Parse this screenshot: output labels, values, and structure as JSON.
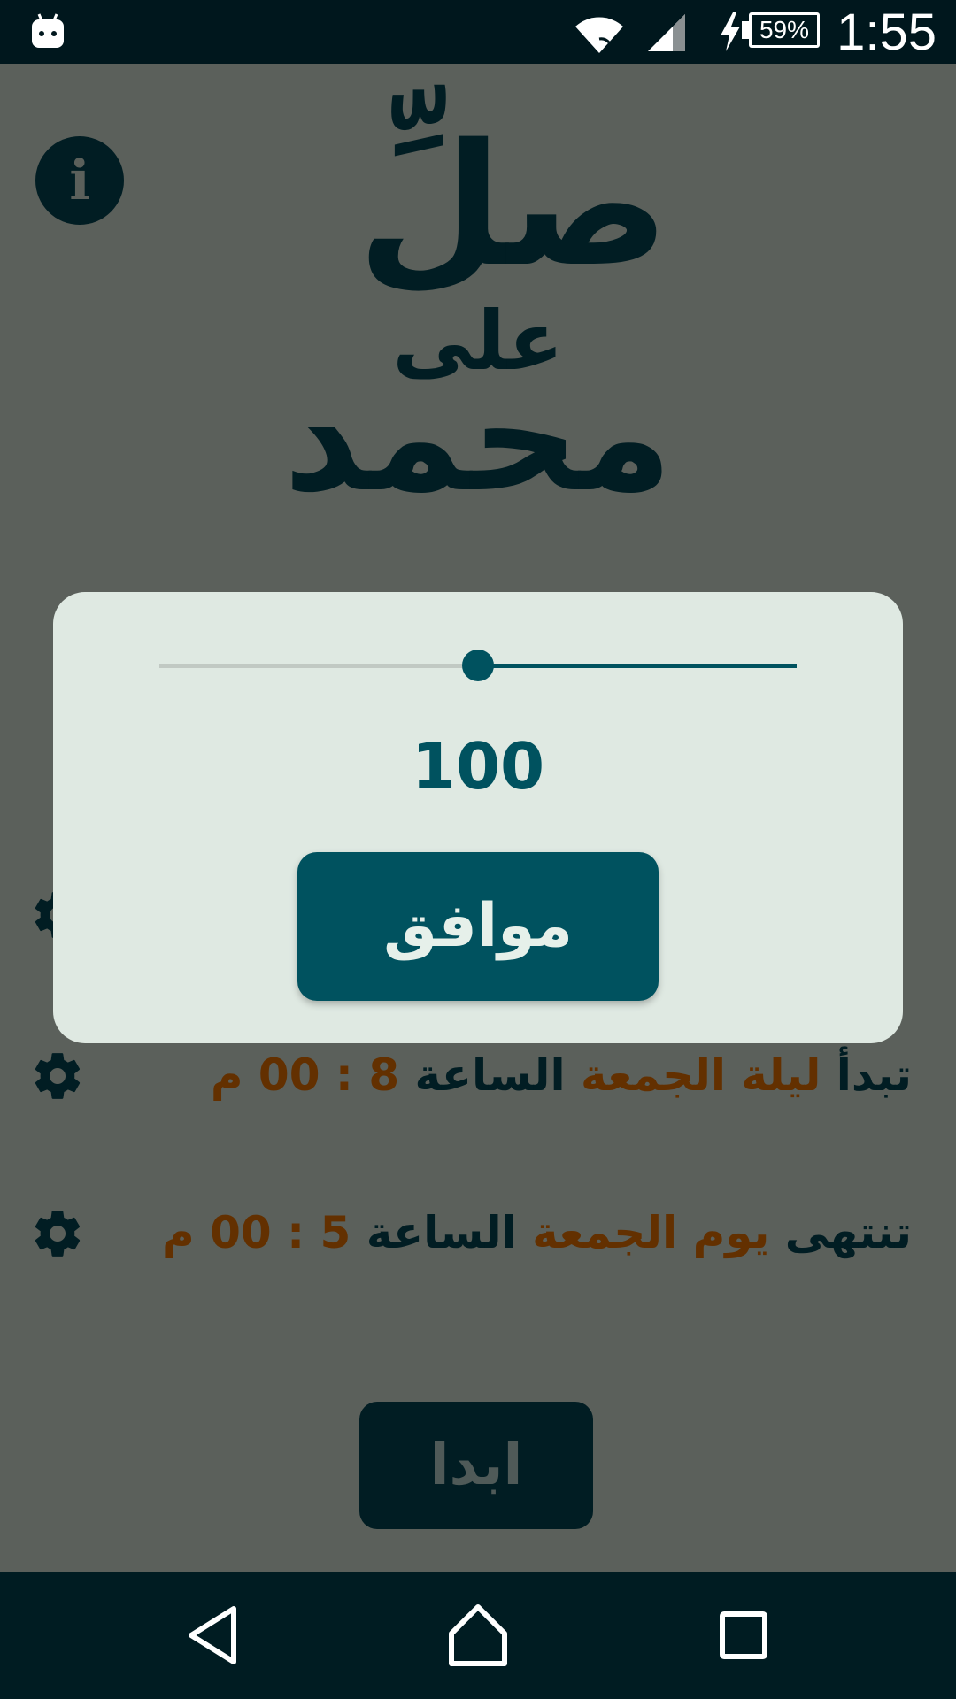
{
  "status_bar": {
    "time": "1:55",
    "battery": "59%",
    "icons": [
      "android-icon",
      "wifi-icon",
      "signal-icon",
      "charging-icon",
      "battery-icon"
    ]
  },
  "title": {
    "line1": "صلِّ",
    "line2": "على",
    "line3": "محمد"
  },
  "schedule": {
    "start": {
      "prefix": "تبدأ",
      "day": "ليلة الجمعة",
      "word": "الساعة",
      "time": "8 : 00 م"
    },
    "end": {
      "prefix": "تنتهى",
      "day": "يوم الجمعة",
      "word": "الساعة",
      "time": "5 : 00 م"
    }
  },
  "start_button": "ابدا",
  "dialog": {
    "slider_fraction": 0.5,
    "value": "100",
    "ok_label": "موافق"
  },
  "colors": {
    "background": "#5b605b",
    "dark": "#011d23",
    "accent": "#633000",
    "teal": "#00525f",
    "dialog_bg": "#dfe9e2"
  },
  "nav": {
    "icons": [
      "back-icon",
      "home-icon",
      "recents-icon"
    ]
  }
}
